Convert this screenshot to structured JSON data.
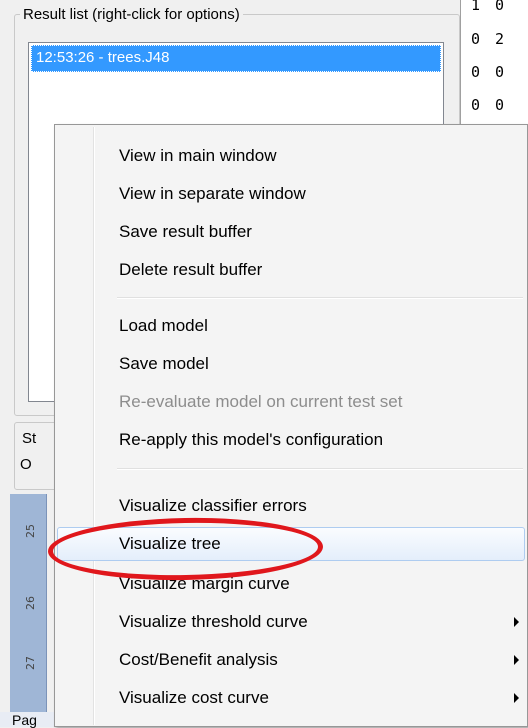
{
  "result_panel": {
    "title": "Result list (right-click for options)",
    "selected_entry": "12:53:26 - trees.J48"
  },
  "matrix_rows": [
    "1 0",
    "0 2",
    "0 0",
    "0 0"
  ],
  "status": {
    "title": "St",
    "text": "O"
  },
  "ruler": {
    "labels": [
      "25",
      "26",
      "27"
    ],
    "page_label": "Pag"
  },
  "context_menu": {
    "items": [
      {
        "label": "View in main window",
        "enabled": true
      },
      {
        "label": "View in separate window",
        "enabled": true
      },
      {
        "label": "Save result buffer",
        "enabled": true
      },
      {
        "label": "Delete result buffer",
        "enabled": true
      },
      {
        "label": "Load model",
        "enabled": true
      },
      {
        "label": "Save model",
        "enabled": true
      },
      {
        "label": "Re-evaluate model on current test set",
        "enabled": false
      },
      {
        "label": "Re-apply this model's configuration",
        "enabled": true
      },
      {
        "label": "Visualize classifier errors",
        "enabled": true
      },
      {
        "label": "Visualize tree",
        "enabled": true,
        "highlighted": true
      },
      {
        "label": "Visualize margin curve",
        "enabled": true
      },
      {
        "label": "Visualize threshold curve",
        "enabled": true,
        "submenu": true
      },
      {
        "label": "Cost/Benefit analysis",
        "enabled": true,
        "submenu": true
      },
      {
        "label": "Visualize cost curve",
        "enabled": true,
        "submenu": true
      }
    ]
  },
  "annotation_color": "#e0171c"
}
